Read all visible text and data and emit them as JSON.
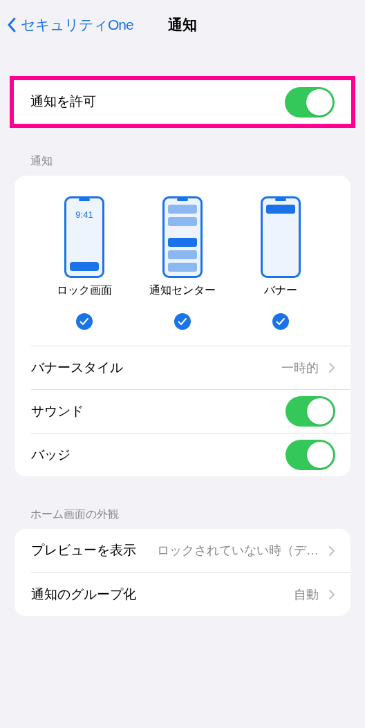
{
  "nav": {
    "back": "セキュリティOne",
    "title": "通知"
  },
  "allow": {
    "label": "通知を許可",
    "on": true,
    "highlighted": true
  },
  "sections": [
    {
      "header": "通知",
      "styles": [
        {
          "kind": "lock",
          "label": "ロック画面",
          "clock": "9:41",
          "checked": true
        },
        {
          "kind": "center",
          "label": "通知センター",
          "checked": true
        },
        {
          "kind": "banner",
          "label": "バナー",
          "checked": true
        }
      ],
      "rows": [
        {
          "kind": "value",
          "label": "バナースタイル",
          "value": "一時的"
        },
        {
          "kind": "toggle",
          "label": "サウンド",
          "on": true
        },
        {
          "kind": "toggle",
          "label": "バッジ",
          "on": true
        }
      ]
    },
    {
      "header": "ホーム画面の外観",
      "rows": [
        {
          "kind": "value",
          "label": "プレビューを表示",
          "value": "ロックされていない時（デ…"
        },
        {
          "kind": "value",
          "label": "通知のグループ化",
          "value": "自動"
        }
      ]
    }
  ]
}
